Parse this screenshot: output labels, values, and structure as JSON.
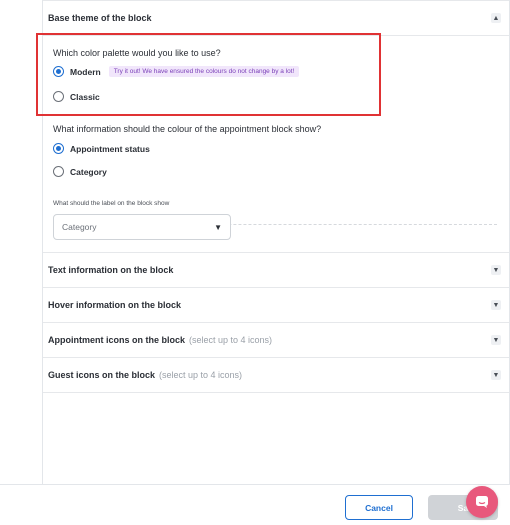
{
  "base_theme": {
    "title": "Base theme of the block",
    "chevron": "chevron-up-icon",
    "palette_question": "Which color palette would you like to use?",
    "palette_options": [
      {
        "label": "Modern",
        "selected": true
      },
      {
        "label": "Classic",
        "selected": false
      }
    ],
    "palette_hint": "Try it out! We have ensured the colours do not change by a lot!",
    "colour_question": "What information should the colour of the appointment block show?",
    "colour_options": [
      {
        "label": "Appointment status",
        "selected": true
      },
      {
        "label": "Category",
        "selected": false
      }
    ],
    "label_question": "What should the label on the block show",
    "label_select_value": "Category"
  },
  "sections": [
    {
      "title": "Text information on the block",
      "note": ""
    },
    {
      "title": "Hover information on the block",
      "note": ""
    },
    {
      "title": "Appointment icons on the block",
      "note": "(select up to 4 icons)"
    },
    {
      "title": "Guest icons on the block",
      "note": "(select up to 4 icons)"
    }
  ],
  "footer": {
    "cancel_label": "Cancel",
    "save_label": "Sa"
  },
  "colors": {
    "accent": "#1f6fd1",
    "highlight_border": "#e03234",
    "hint_bg": "#f1e6fb",
    "chat_fab": "#e8587c"
  }
}
